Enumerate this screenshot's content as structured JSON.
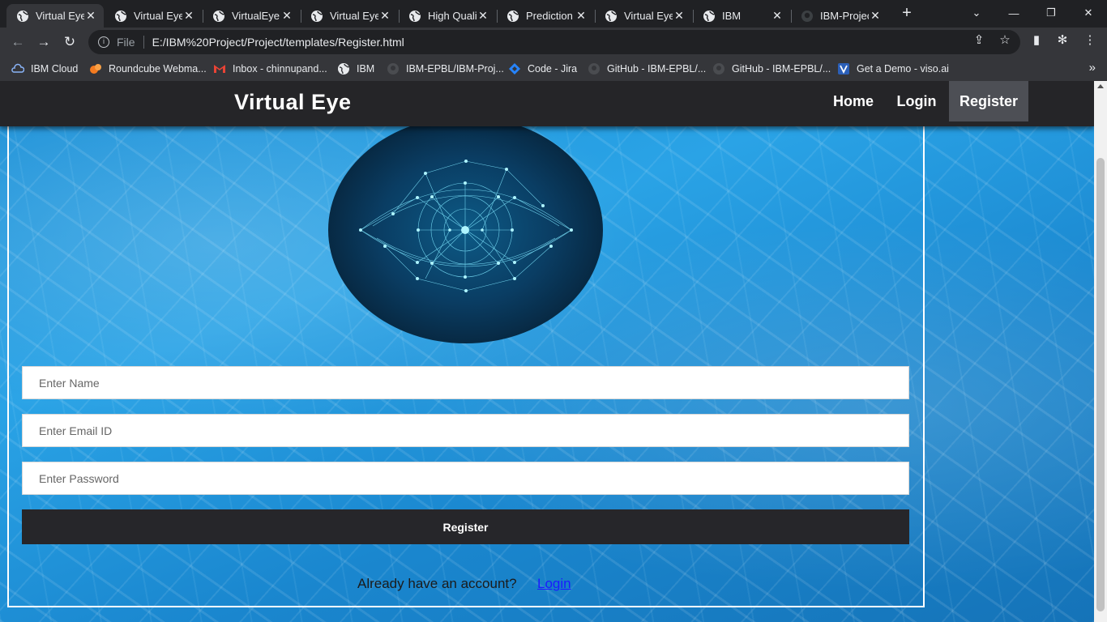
{
  "browser": {
    "tabs": [
      {
        "title": "Virtual Eye",
        "active": true
      },
      {
        "title": "Virtual Eye",
        "active": false
      },
      {
        "title": "VirtualEye",
        "active": false
      },
      {
        "title": "Virtual Eye",
        "active": false
      },
      {
        "title": "High Quali",
        "active": false
      },
      {
        "title": "Prediction",
        "active": false
      },
      {
        "title": "Virtual Eye",
        "active": false
      },
      {
        "title": "IBM",
        "active": false
      },
      {
        "title": "IBM-Projec",
        "active": false
      }
    ],
    "address": {
      "scheme": "File",
      "url": "E:/IBM%20Project/Project/templates/Register.html"
    },
    "bookmarks": [
      {
        "label": "IBM Cloud",
        "icon": "ibm-cloud-icon"
      },
      {
        "label": "Roundcube Webma...",
        "icon": "roundcube-icon"
      },
      {
        "label": "Inbox - chinnupand...",
        "icon": "gmail-icon"
      },
      {
        "label": "IBM",
        "icon": "globe-icon"
      },
      {
        "label": "IBM-EPBL/IBM-Proj...",
        "icon": "github-icon"
      },
      {
        "label": "Code - Jira",
        "icon": "jira-icon"
      },
      {
        "label": "GitHub - IBM-EPBL/...",
        "icon": "github-icon"
      },
      {
        "label": "GitHub - IBM-EPBL/...",
        "icon": "github-icon"
      },
      {
        "label": "Get a Demo - viso.ai",
        "icon": "viso-icon"
      }
    ]
  },
  "page": {
    "brand": "Virtual Eye",
    "nav": {
      "home": "Home",
      "login": "Login",
      "register": "Register"
    },
    "form": {
      "name_placeholder": "Enter Name",
      "email_placeholder": "Enter Email ID",
      "password_placeholder": "Enter Password",
      "submit_label": "Register"
    },
    "footer": {
      "prompt": "Already have an account?",
      "login_link": "Login"
    }
  },
  "colors": {
    "navbar": "#252528",
    "nav_active": "#4d4f55",
    "button": "#26262a",
    "link": "#1a1aff"
  }
}
